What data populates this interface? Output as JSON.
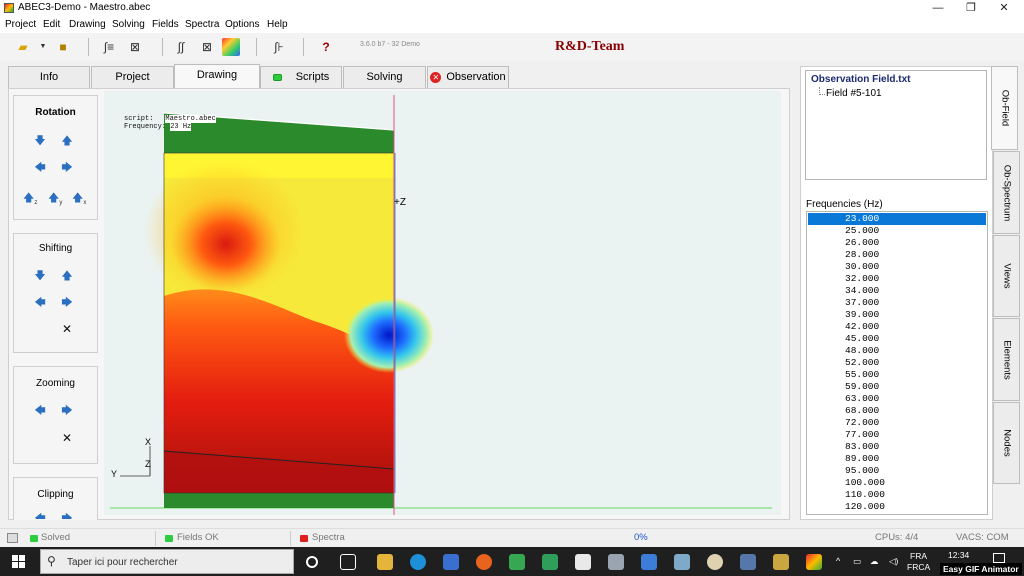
{
  "window": {
    "title": "ABEC3-Demo - Maestro.abec",
    "controls": [
      "—",
      "❐",
      "✕"
    ]
  },
  "menu": [
    "Project",
    "Edit",
    "Drawing",
    "Solving",
    "Fields",
    "Spectra",
    "Options",
    "Help"
  ],
  "toolbar": {
    "version": "3.6.0 b7 - 32 Demo",
    "brand": "R&D-Team"
  },
  "tabs": [
    {
      "label": "Info"
    },
    {
      "label": "Project"
    },
    {
      "label": "Drawing",
      "active": true
    },
    {
      "label": "Scripts",
      "status_color": "#2ecc40"
    },
    {
      "label": "Solving"
    },
    {
      "label": "Observation",
      "status": "error"
    }
  ],
  "controls": {
    "rotation": {
      "title": "Rotation",
      "axis_buttons": [
        "z",
        "y",
        "x"
      ]
    },
    "shifting": {
      "title": "Shifting"
    },
    "zooming": {
      "title": "Zooming"
    },
    "clipping": {
      "title": "Clipping"
    }
  },
  "canvas": {
    "script_label": "script:",
    "script_value": "Maestro.abec",
    "frequency_label": "Frequency:",
    "frequency_value": "23 Hz",
    "axis_z": "+Z",
    "axes": {
      "x": "X",
      "y": "Y",
      "z": "Z"
    }
  },
  "observation": {
    "file": "Observation Field.txt",
    "field": "Field #5-101"
  },
  "frequencies": {
    "label": "Frequencies  (Hz)",
    "selected": "23.000",
    "items": [
      "23.000",
      "25.000",
      "26.000",
      "28.000",
      "30.000",
      "32.000",
      "34.000",
      "37.000",
      "39.000",
      "42.000",
      "45.000",
      "48.000",
      "52.000",
      "55.000",
      "59.000",
      "63.000",
      "68.000",
      "72.000",
      "77.000",
      "83.000",
      "89.000",
      "95.000",
      "100.000",
      "110.000",
      "120.000"
    ]
  },
  "side_tabs": [
    "Ob-Field",
    "Ob-Spectrum",
    "Views",
    "Elements",
    "Nodes"
  ],
  "status": {
    "solved": "Solved",
    "fields": "Fields OK",
    "spectra": "Spectra",
    "progress": "0%",
    "cpus": "CPUs: 4/4",
    "vacs": "VACS: COM"
  },
  "taskbar": {
    "search_placeholder": "Taper ici pour rechercher",
    "lang1": "FRA",
    "lang2": "FRCA",
    "time": "12:34",
    "watermark": "Easy GIF Animator"
  }
}
